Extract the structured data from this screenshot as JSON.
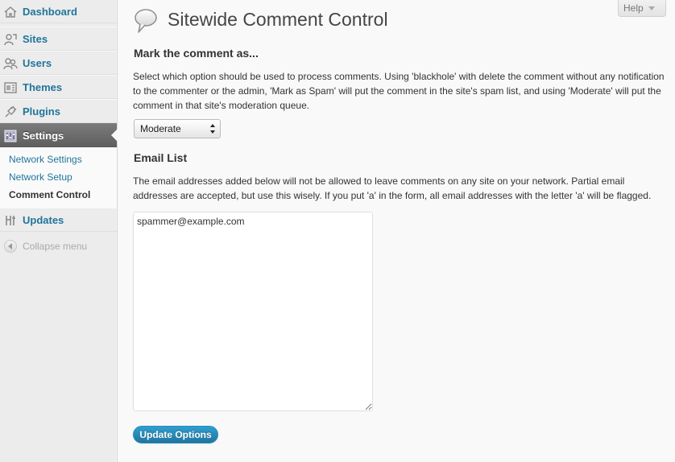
{
  "sidebar": {
    "items": [
      {
        "label": "Dashboard",
        "icon": "home-icon"
      },
      {
        "label": "Sites",
        "icon": "sites-icon"
      },
      {
        "label": "Users",
        "icon": "users-icon"
      },
      {
        "label": "Themes",
        "icon": "themes-icon"
      },
      {
        "label": "Plugins",
        "icon": "plugins-icon"
      },
      {
        "label": "Settings",
        "icon": "settings-icon",
        "current": true
      },
      {
        "label": "Updates",
        "icon": "updates-icon"
      }
    ],
    "submenu": [
      {
        "label": "Network Settings"
      },
      {
        "label": "Network Setup"
      },
      {
        "label": "Comment Control",
        "current": true
      }
    ],
    "collapse_label": "Collapse menu"
  },
  "header": {
    "help_label": "Help",
    "title": "Sitewide Comment Control",
    "icon": "speech-bubble-icon"
  },
  "main": {
    "mark_section": {
      "title": "Mark the comment as...",
      "description": "Select which option should be used to process comments. Using 'blackhole' with delete the comment without any notification to the commenter or the admin, 'Mark as Spam' will put the comment in the site's spam list, and using 'Moderate' will put the comment in that site's moderation queue.",
      "select_value": "Moderate"
    },
    "email_section": {
      "title": "Email List",
      "description": "The email addresses added below will not be allowed to leave comments on any site on your network. Partial email addresses are accepted, but use this wisely. If you put 'a' in the form, all email addresses with the letter 'a' will be flagged.",
      "textarea_value": "spammer@example.com"
    },
    "submit_label": "Update Options"
  },
  "colors": {
    "link": "#21759b",
    "button": "#21759b",
    "current_menu_bg": "#6d6d6d",
    "sidebar_bg": "#ececec",
    "page_bg": "#f9f9f9"
  }
}
